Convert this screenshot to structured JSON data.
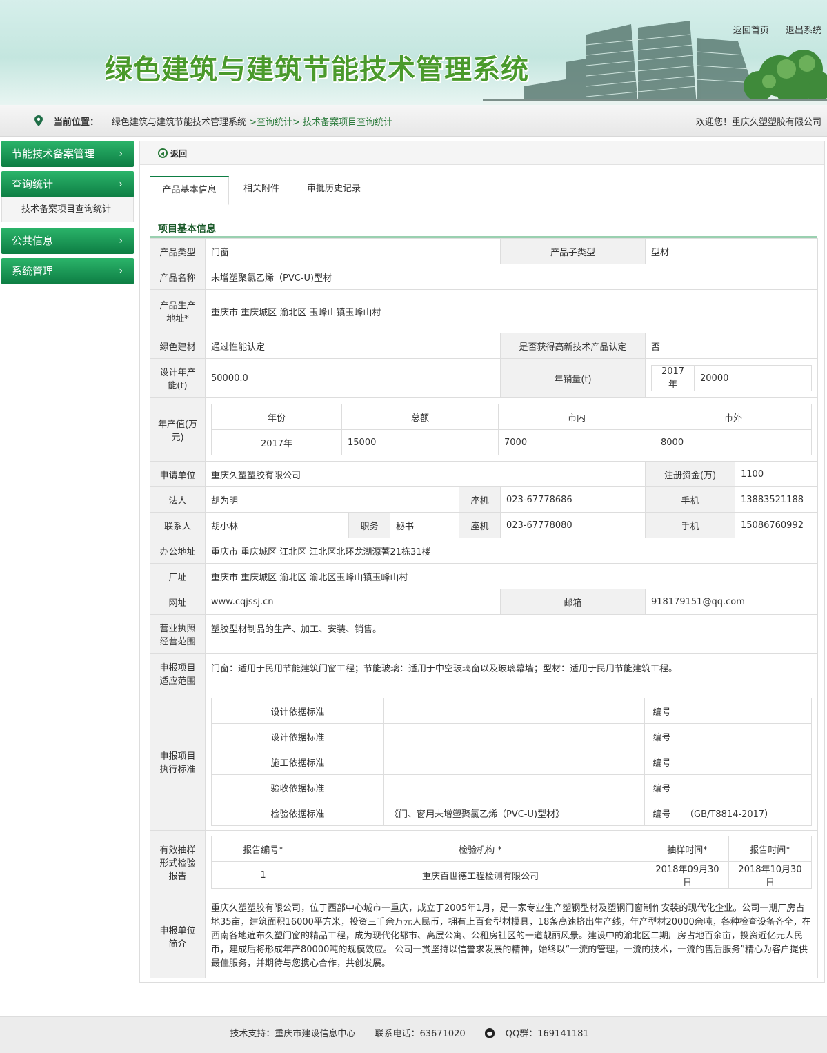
{
  "header": {
    "title": "绿色建筑与建筑节能技术管理系统",
    "home_link": "返回首页",
    "logout_link": "退出系统"
  },
  "location": {
    "label": "当前位置：",
    "crumb1": "绿色建筑与建筑节能技术管理系统",
    "crumb2": ">查询统计>",
    "crumb3": "技术备案项目查询统计",
    "welcome": "欢迎您！重庆久塑塑胶有限公司"
  },
  "sidebar": {
    "items": [
      {
        "label": "节能技术备案管理",
        "arrow": "›"
      },
      {
        "label": "查询统计",
        "arrow": "›"
      },
      {
        "label": "公共信息",
        "arrow": "›"
      },
      {
        "label": "系统管理",
        "arrow": "›"
      }
    ],
    "sub_item": "技术备案项目查询统计"
  },
  "main": {
    "back_label": "返回",
    "tabs": [
      "产品基本信息",
      "相关附件",
      "审批历史记录"
    ],
    "section_title": "项目基本信息"
  },
  "info": {
    "product_type_label": "产品类型",
    "product_type": "门窗",
    "product_subtype_label": "产品子类型",
    "product_subtype": "型材",
    "product_name_label": "产品名称",
    "product_name": "未增塑聚氯乙烯（PVC-U)型材",
    "product_addr_label": "产品生产地址*",
    "product_addr": "重庆市  重庆城区  渝北区  玉峰山镇玉峰山村",
    "green_label": "绿色建材",
    "green_value": "通过性能认定",
    "hightech_label": "是否获得高新技术产品认定",
    "hightech_value": "否",
    "design_cap_label": "设计年产能(t)",
    "design_cap": "50000.0",
    "annual_sales_label": "年销量(t)",
    "annual_sales_year": "2017年",
    "annual_sales_value": "20000",
    "output_label": "年产值(万元)",
    "output_headers": [
      "年份",
      "总额",
      "市内",
      "市外"
    ],
    "output_row": [
      "2017年",
      "15000",
      "7000",
      "8000"
    ],
    "applicant_label": "申请单位",
    "applicant": "重庆久塑塑胶有限公司",
    "capital_label": "注册资金(万)",
    "capital": "1100",
    "legal_label": "法人",
    "legal": "胡为明",
    "phone_label": "座机",
    "legal_phone": "023-67778686",
    "mobile_label": "手机",
    "legal_mobile": "13883521188",
    "contact_label": "联系人",
    "contact": "胡小林",
    "position_label": "职务",
    "position": "秘书",
    "contact_phone": "023-67778080",
    "contact_mobile": "15086760992",
    "office_label": "办公地址",
    "office": "重庆市  重庆城区  江北区  江北区北环龙湖源著21栋31楼",
    "factory_label": "厂址",
    "factory": "重庆市  重庆城区  渝北区  渝北区玉峰山镇玉峰山村",
    "web_label": "网址",
    "web": "www.cqjssj.cn",
    "email_label": "邮箱",
    "email": "918179151@qq.com",
    "license_label": "营业执照经营范围",
    "license": "塑胶型材制品的生产、加工、安装、销售。",
    "scope_label": "申报项目适应范围",
    "scope": "门窗：适用于民用节能建筑门窗工程；节能玻璃：适用于中空玻璃窗以及玻璃幕墙；型材：适用于民用节能建筑工程。",
    "standards_label": "申报项目执行标准",
    "number_label": "编号",
    "standards": [
      {
        "type": "设计依据标准",
        "name": "",
        "number": ""
      },
      {
        "type": "设计依据标准",
        "name": "",
        "number": ""
      },
      {
        "type": "施工依据标准",
        "name": "",
        "number": ""
      },
      {
        "type": "验收依据标准",
        "name": "",
        "number": ""
      },
      {
        "type": "检验依据标准",
        "name": "《门、窗用未增塑聚氯乙烯（PVC-U)型材》",
        "number": "（GB/T8814-2017）"
      }
    ],
    "report_label": "有效抽样形式检验报告",
    "report_headers": [
      "报告编号*",
      "检验机构 *",
      "抽样时间*",
      "报告时间*"
    ],
    "report_row": [
      "1",
      "重庆百世德工程检测有限公司",
      "2018年09月30日",
      "2018年10月30日"
    ],
    "intro_label": "申报单位简介",
    "intro": "重庆久塑塑胶有限公司，位于西部中心城市一重庆，成立于2005年1月，是一家专业生产塑钢型材及塑钢门窗制作安装的现代化企业。公司一期厂房占地35亩，建筑面积16000平方米，投资三千余万元人民币，拥有上百套型材模具，18条高速挤出生产线，年产型材20000余吨，各种检查设备齐全，在西南各地遍布久塑门窗的精品工程，成为现代化都市、高层公寓、公租房社区的一道靓丽风景。建设中的渝北区二期厂房占地百余亩，投资近亿元人民币，建成后将形成年产80000吨的规模效应。 公司一贯坚持以信誉求发展的精神，始终以“一流的管理，一流的技术，一流的售后服务”精心为客户提供最佳服务，并期待与您携心合作，共创发展。"
  },
  "footer": {
    "support": "技术支持：重庆市建设信息中心",
    "phone": "联系电话：63671020",
    "qq": "QQ群：169141181"
  }
}
